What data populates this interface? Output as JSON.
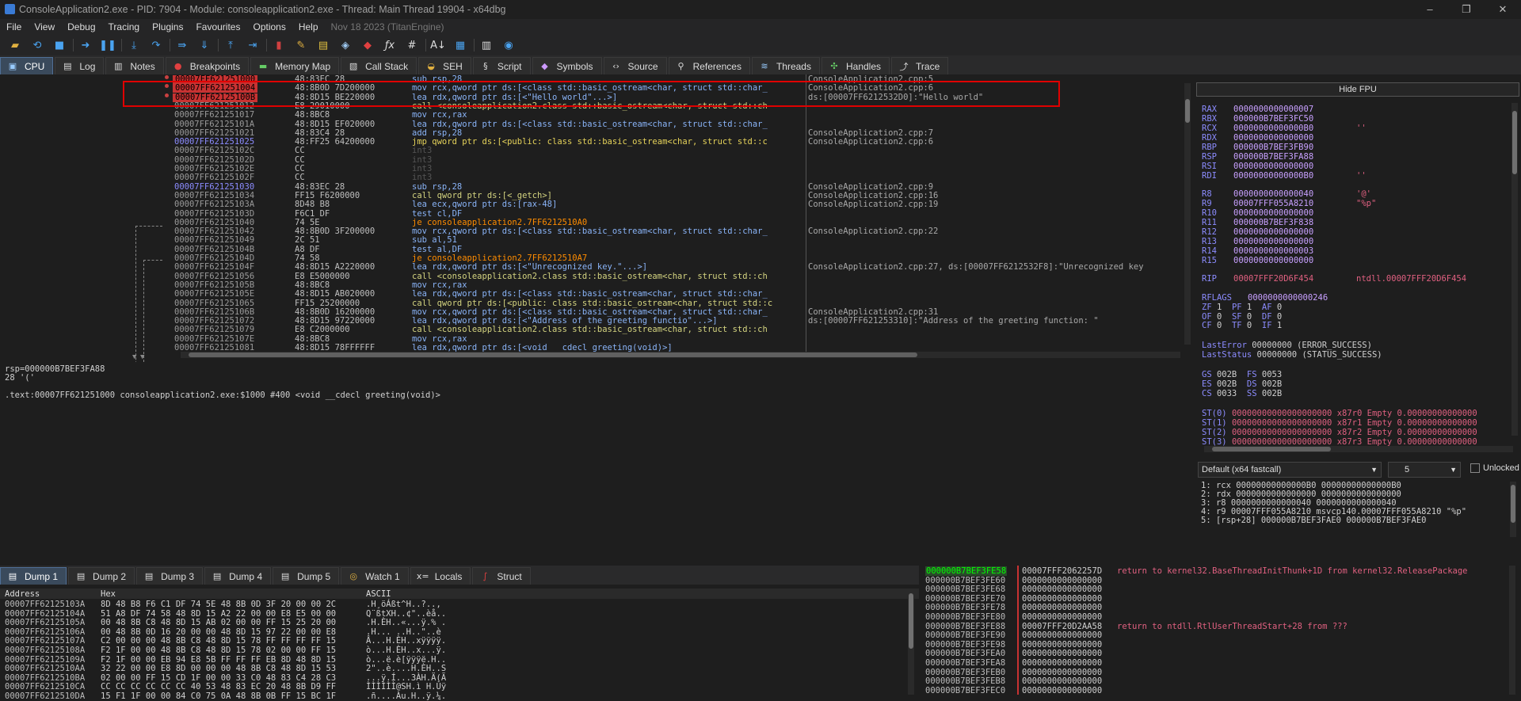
{
  "window": {
    "title": "ConsoleApplication2.exe - PID: 7904 - Module: consoleapplication2.exe - Thread: Main Thread 19904 - x64dbg"
  },
  "menu": {
    "items": [
      "File",
      "View",
      "Debug",
      "Tracing",
      "Plugins",
      "Favourites",
      "Options",
      "Help"
    ],
    "build": "Nov 18 2023 (TitanEngine)"
  },
  "toolbar": {
    "icons": [
      "open-icon",
      "restart-icon",
      "stop-icon",
      "run-icon",
      "pause-icon",
      "step-into-icon",
      "step-over-icon",
      "trace-into-icon",
      "trace-over-icon",
      "execute-till-return-icon",
      "run-to-user-code-icon",
      "scylla-icon",
      "highlight-icon",
      "comment-icon",
      "label-icon",
      "bookmark-icon",
      "function-icon",
      "hash-icon",
      "strings-icon",
      "patch-icon",
      "calculator-icon",
      "globe-icon"
    ]
  },
  "main_tabs": [
    "CPU",
    "Log",
    "Notes",
    "Breakpoints",
    "Memory Map",
    "Call Stack",
    "SEH",
    "Script",
    "Symbols",
    "Source",
    "References",
    "Threads",
    "Handles",
    "Trace"
  ],
  "disasm": {
    "rows": [
      {
        "addr": "00007FF621251000",
        "bytes": "48:83EC 28",
        "ins": "sub rsp,28",
        "com": "ConsoleApplication2.cpp:5",
        "style": "hl",
        "bp": true
      },
      {
        "addr": "00007FF621251004",
        "bytes": "48:8B0D 7D200000",
        "ins": "mov rcx,qword ptr ds:[<class std::basic_ostream<char, struct std::char_",
        "com": "ConsoleApplication2.cpp:6",
        "style": "hl",
        "bp": true
      },
      {
        "addr": "00007FF62125100B",
        "bytes": "48:8D15 BE220000",
        "ins": "lea rdx,qword ptr ds:[<\"Hello world\"...>]",
        "com": "ds:[00007FF6212532D0]:\"Hello world\"",
        "style": "hl",
        "bp": true
      },
      {
        "addr": "00007FF621251012",
        "bytes": "E8 29010000",
        "ins": "call <consoleapplication2.class std::basic_ostream<char, struct std::ch",
        "com": "",
        "style": "",
        "bp": false,
        "kind": "call"
      },
      {
        "addr": "00007FF621251017",
        "bytes": "48:8BC8",
        "ins": "mov rcx,rax",
        "com": "",
        "style": "",
        "bp": false
      },
      {
        "addr": "00007FF62125101A",
        "bytes": "48:8D15 EF020000",
        "ins": "lea rdx,qword ptr ds:[<class std::basic_ostream<char, struct std::char_",
        "com": "",
        "style": "",
        "bp": false
      },
      {
        "addr": "00007FF621251021",
        "bytes": "48:83C4 28",
        "ins": "add rsp,28",
        "com": "ConsoleApplication2.cpp:7",
        "style": "",
        "bp": false
      },
      {
        "addr": "00007FF621251025",
        "bytes": "48:FF25 64200000",
        "ins": "jmp qword ptr ds:[<public: class std::basic_ostream<char, struct std::c",
        "com": "ConsoleApplication2.cpp:6",
        "style": "lbl",
        "bp": false,
        "kind": "jmp"
      },
      {
        "addr": "00007FF62125102C",
        "bytes": "CC",
        "ins": "int3",
        "com": "",
        "style": "",
        "bp": false,
        "kind": "pad"
      },
      {
        "addr": "00007FF62125102D",
        "bytes": "CC",
        "ins": "int3",
        "com": "",
        "style": "",
        "bp": false,
        "kind": "pad"
      },
      {
        "addr": "00007FF62125102E",
        "bytes": "CC",
        "ins": "int3",
        "com": "",
        "style": "",
        "bp": false,
        "kind": "pad"
      },
      {
        "addr": "00007FF62125102F",
        "bytes": "CC",
        "ins": "int3",
        "com": "",
        "style": "",
        "bp": false,
        "kind": "pad"
      },
      {
        "addr": "00007FF621251030",
        "bytes": "48:83EC 28",
        "ins": "sub rsp,28",
        "com": "ConsoleApplication2.cpp:9",
        "style": "lbl",
        "bp": false
      },
      {
        "addr": "00007FF621251034",
        "bytes": "FF15 F6200000",
        "ins": "call qword ptr ds:[<_getch>]",
        "com": "ConsoleApplication2.cpp:16",
        "style": "",
        "bp": false,
        "kind": "call"
      },
      {
        "addr": "00007FF62125103A",
        "bytes": "8D48 B8",
        "ins": "lea ecx,qword ptr ds:[rax-48]",
        "com": "ConsoleApplication2.cpp:19",
        "style": "",
        "bp": false
      },
      {
        "addr": "00007FF62125103D",
        "bytes": "F6C1 DF",
        "ins": "test cl,DF",
        "com": "",
        "style": "",
        "bp": false
      },
      {
        "addr": "00007FF621251040",
        "bytes": "74 5E",
        "ins": "je consoleapplication2.7FF6212510A0",
        "com": "",
        "style": "",
        "bp": false,
        "kind": "je"
      },
      {
        "addr": "00007FF621251042",
        "bytes": "48:8B0D 3F200000",
        "ins": "mov rcx,qword ptr ds:[<class std::basic_ostream<char, struct std::char_",
        "com": "ConsoleApplication2.cpp:22",
        "style": "",
        "bp": false
      },
      {
        "addr": "00007FF621251049",
        "bytes": "2C 51",
        "ins": "sub al,51",
        "com": "",
        "style": "",
        "bp": false
      },
      {
        "addr": "00007FF62125104B",
        "bytes": "A8 DF",
        "ins": "test al,DF",
        "com": "",
        "style": "",
        "bp": false
      },
      {
        "addr": "00007FF62125104D",
        "bytes": "74 58",
        "ins": "je consoleapplication2.7FF6212510A7",
        "com": "",
        "style": "",
        "bp": false,
        "kind": "je"
      },
      {
        "addr": "00007FF62125104F",
        "bytes": "48:8D15 A2220000",
        "ins": "lea rdx,qword ptr ds:[<\"Unrecognized key.\"...>]",
        "com": "ConsoleApplication2.cpp:27, ds:[00007FF6212532F8]:\"Unrecognized key",
        "style": "",
        "bp": false
      },
      {
        "addr": "00007FF621251056",
        "bytes": "E8 E5000000",
        "ins": "call <consoleapplication2.class std::basic_ostream<char, struct std::ch",
        "com": "",
        "style": "",
        "bp": false,
        "kind": "call"
      },
      {
        "addr": "00007FF62125105B",
        "bytes": "48:8BC8",
        "ins": "mov rcx,rax",
        "com": "",
        "style": "",
        "bp": false
      },
      {
        "addr": "00007FF62125105E",
        "bytes": "48:8D15 AB020000",
        "ins": "lea rdx,qword ptr ds:[<class std::basic_ostream<char, struct std::char_",
        "com": "",
        "style": "",
        "bp": false
      },
      {
        "addr": "00007FF621251065",
        "bytes": "FF15 25200000",
        "ins": "call qword ptr ds:[<public: class std::basic_ostream<char, struct std::c",
        "com": "",
        "style": "",
        "bp": false,
        "kind": "call"
      },
      {
        "addr": "00007FF62125106B",
        "bytes": "48:8B0D 16200000",
        "ins": "mov rcx,qword ptr ds:[<class std::basic_ostream<char, struct std::char_",
        "com": "ConsoleApplication2.cpp:31",
        "style": "",
        "bp": false
      },
      {
        "addr": "00007FF621251072",
        "bytes": "48:8D15 97220000",
        "ins": "lea rdx,qword ptr ds:[<\"Address of the greeting functio\"...>]",
        "com": "ds:[00007FF621253310]:\"Address of the greeting function: \"",
        "style": "",
        "bp": false
      },
      {
        "addr": "00007FF621251079",
        "bytes": "E8 C2000000",
        "ins": "call <consoleapplication2.class std::basic_ostream<char, struct std::ch",
        "com": "",
        "style": "",
        "bp": false,
        "kind": "call"
      },
      {
        "addr": "00007FF62125107E",
        "bytes": "48:8BC8",
        "ins": "mov rcx,rax",
        "com": "",
        "style": "",
        "bp": false
      },
      {
        "addr": "00007FF621251081",
        "bytes": "48:8D15 78FFFFFF",
        "ins": "lea rdx,qword ptr ds:[<void __cdecl greeting(void)>]",
        "com": "",
        "style": "",
        "bp": false
      }
    ]
  },
  "info": {
    "line1": "rsp=000000B7BEF3FA88",
    "line2": "28 '('",
    "line3": ".text:00007FF621251000 consoleapplication2.exe:$1000 #400 <void __cdecl greeting(void)>"
  },
  "registers": {
    "hide_fpu": "Hide FPU",
    "gp": [
      {
        "n": "RAX",
        "v": "0000000000000007",
        "x": ""
      },
      {
        "n": "RBX",
        "v": "000000B7BEF3FC50",
        "x": ""
      },
      {
        "n": "RCX",
        "v": "00000000000000B0",
        "x": "''"
      },
      {
        "n": "RDX",
        "v": "0000000000000000",
        "x": ""
      },
      {
        "n": "RBP",
        "v": "000000B7BEF3FB90",
        "x": ""
      },
      {
        "n": "RSP",
        "v": "000000B7BEF3FA88",
        "x": ""
      },
      {
        "n": "RSI",
        "v": "0000000000000000",
        "x": ""
      },
      {
        "n": "RDI",
        "v": "00000000000000B0",
        "x": "''"
      }
    ],
    "ext": [
      {
        "n": "R8",
        "v": "0000000000000040",
        "x": "'@'"
      },
      {
        "n": "R9",
        "v": "00007FFF055A8210",
        "x": "\"%p\""
      },
      {
        "n": "R10",
        "v": "0000000000000000",
        "x": ""
      },
      {
        "n": "R11",
        "v": "000000B7BEF3F838",
        "x": ""
      },
      {
        "n": "R12",
        "v": "0000000000000000",
        "x": ""
      },
      {
        "n": "R13",
        "v": "0000000000000000",
        "x": ""
      },
      {
        "n": "R14",
        "v": "0000000000000003",
        "x": ""
      },
      {
        "n": "R15",
        "v": "0000000000000000",
        "x": ""
      }
    ],
    "rip": {
      "n": "RIP",
      "v": "00007FFF20D6F454",
      "x": "ntdll.00007FFF20D6F454"
    },
    "rflags": {
      "n": "RFLAGS",
      "v": "0000000000000246"
    },
    "flags": [
      [
        "ZF",
        "1",
        "PF",
        "1",
        "AF",
        "0"
      ],
      [
        "OF",
        "0",
        "SF",
        "0",
        "DF",
        "0"
      ],
      [
        "CF",
        "0",
        "TF",
        "0",
        "IF",
        "1"
      ]
    ],
    "last_error": {
      "n": "LastError",
      "v": "00000000 (ERROR_SUCCESS)"
    },
    "last_status": {
      "n": "LastStatus",
      "v": "00000000 (STATUS_SUCCESS)"
    },
    "seg": [
      [
        "GS",
        "002B",
        "FS",
        "0053"
      ],
      [
        "ES",
        "002B",
        "DS",
        "002B"
      ],
      [
        "CS",
        "0033",
        "SS",
        "002B"
      ]
    ],
    "fpu": [
      {
        "n": "ST(0)",
        "v": "00000000000000000000 x87r0 Empty 0.00000000000000"
      },
      {
        "n": "ST(1)",
        "v": "00000000000000000000 x87r1 Empty 0.00000000000000"
      },
      {
        "n": "ST(2)",
        "v": "00000000000000000000 x87r2 Empty 0.00000000000000"
      },
      {
        "n": "ST(3)",
        "v": "00000000000000000000 x87r3 Empty 0.00000000000000"
      }
    ]
  },
  "callstack_args": {
    "convention": "Default (x64 fastcall)",
    "count": "5",
    "unlocked": "Unlocked",
    "rows": [
      "1: rcx 00000000000000B0 00000000000000B0",
      "2: rdx 0000000000000000 0000000000000000",
      "3: r8 0000000000000040 0000000000000040",
      "4: r9 00007FFF055A8210 msvcp140.00007FFF055A8210 \"%p\"",
      "5: [rsp+28] 000000B7BEF3FAE0 000000B7BEF3FAE0"
    ]
  },
  "dump_tabs": [
    "Dump 1",
    "Dump 2",
    "Dump 3",
    "Dump 4",
    "Dump 5",
    "Watch 1",
    "Locals",
    "Struct"
  ],
  "dump": {
    "headers": {
      "addr": "Address",
      "hex": "Hex",
      "ascii": "ASCII"
    },
    "rows": [
      {
        "a": "00007FF62125103A",
        "h": "8D 48 B8 F6 C1 DF 74 5E 48 8B 0D 3F 20 00 00 2C",
        "t": ".H¸öÁßt^H..?..,"
      },
      {
        "a": "00007FF62125104A",
        "h": "51 A8 DF 74 58 48 8D 15 A2 22 00 00 E8 E5 00 00",
        "t": "Q¨ßtXH..¢\"..èå.."
      },
      {
        "a": "00007FF62125105A",
        "h": "00 48 8B C8 48 8D 15 AB 02 00 00 FF 15 25 20 00",
        "t": ".H.ÈH..«...ÿ.% ."
      },
      {
        "a": "00007FF62125106A",
        "h": "00 48 8B 0D 16 20 00 00 48 8D 15 97 22 00 00 E8",
        "t": ".H... ..H..\"..è"
      },
      {
        "a": "00007FF62125107A",
        "h": "C2 00 00 00 48 8B C8 48 8D 15 78 FF FF FF FF 15",
        "t": "Â...H.ÈH..xÿÿÿÿ."
      },
      {
        "a": "00007FF62125108A",
        "h": "F2 1F 00 00 48 8B C8 48 8D 15 78 02 00 00 FF 15",
        "t": "ò...H.ÈH..x...ÿ."
      },
      {
        "a": "00007FF62125109A",
        "h": "F2 1F 00 00 EB 94 E8 5B FF FF FF EB 8D 48 8D 15",
        "t": "ò...ë.è[ÿÿÿë.H.."
      },
      {
        "a": "00007FF6212510AA",
        "h": "32 22 00 00 E8 8D 00 00 00 48 8B C8 48 8D 15 53",
        "t": "2\"..è....H.ÈH..S"
      },
      {
        "a": "00007FF6212510BA",
        "h": "02 00 00 FF 15 CD 1F 00 00 33 C0 48 83 C4 28 C3",
        "t": "...ÿ.Í...3ÀH.Ä(Ã"
      },
      {
        "a": "00007FF6212510CA",
        "h": "CC CC CC CC CC CC 40 53 48 83 EC 20 48 8B D9 FF",
        "t": "ÌÌÌÌÌÌ@SH.ì H.Ùÿ"
      },
      {
        "a": "00007FF6212510DA",
        "h": "15 F1 1F 00 00 84 C0 75 0A 48 8B 0B FF 15 BC 1F",
        "t": ".ñ....Àu.H..ÿ.¼."
      }
    ]
  },
  "stack": {
    "rows": [
      {
        "a": "000000B7BEF3FE58",
        "v": "00007FFF2062257D",
        "c": "return to kernel32.BaseThreadInitThunk+1D from kernel32.ReleasePackage"
      },
      {
        "a": "000000B7BEF3FE60",
        "v": "0000000000000000",
        "c": ""
      },
      {
        "a": "000000B7BEF3FE68",
        "v": "0000000000000000",
        "c": ""
      },
      {
        "a": "000000B7BEF3FE70",
        "v": "0000000000000000",
        "c": ""
      },
      {
        "a": "000000B7BEF3FE78",
        "v": "0000000000000000",
        "c": ""
      },
      {
        "a": "000000B7BEF3FE80",
        "v": "0000000000000000",
        "c": ""
      },
      {
        "a": "000000B7BEF3FE88",
        "v": "00007FFF20D2AA58",
        "c": "return to ntdll.RtlUserThreadStart+28 from ???"
      },
      {
        "a": "000000B7BEF3FE90",
        "v": "0000000000000000",
        "c": ""
      },
      {
        "a": "000000B7BEF3FE98",
        "v": "0000000000000000",
        "c": ""
      },
      {
        "a": "000000B7BEF3FEA0",
        "v": "0000000000000000",
        "c": ""
      },
      {
        "a": "000000B7BEF3FEA8",
        "v": "0000000000000000",
        "c": ""
      },
      {
        "a": "000000B7BEF3FEB0",
        "v": "0000000000000000",
        "c": ""
      },
      {
        "a": "000000B7BEF3FEB8",
        "v": "0000000000000000",
        "c": ""
      },
      {
        "a": "000000B7BEF3FEC0",
        "v": "0000000000000000",
        "c": ""
      }
    ]
  }
}
